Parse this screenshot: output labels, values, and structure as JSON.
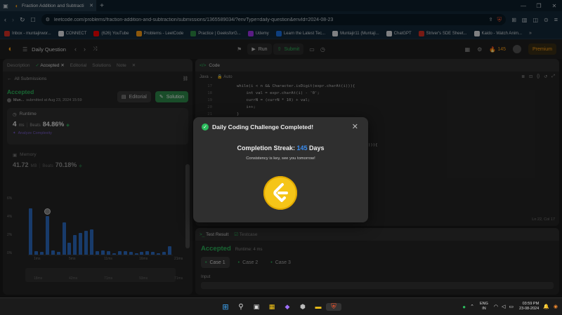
{
  "browser": {
    "tab_title": "Fraction Addition and Subtracti",
    "url": "leetcode.com/problems/fraction-addition-and-subtraction/submissions/1365589034/?envType=daily-question&envId=2024-08-23"
  },
  "bookmarks": [
    {
      "label": "Inbox - muntajirwor...",
      "color": "#d93025"
    },
    {
      "label": "CONNECT",
      "color": "#e8eaed"
    },
    {
      "label": "(626) YouTube",
      "color": "#ff0000"
    },
    {
      "label": "Problems - LeetCode",
      "color": "#ffa116"
    },
    {
      "label": "Practice | GeeksforG...",
      "color": "#2f8d46"
    },
    {
      "label": "Udemy",
      "color": "#a435f0"
    },
    {
      "label": "Learn the Latest Tec...",
      "color": "#1a73e8"
    },
    {
      "label": "Muntajir11 (Muntaji...",
      "color": "#e8eaed"
    },
    {
      "label": "ChatGPT",
      "color": "#e8eaed"
    },
    {
      "label": "Striver's SDE Sheet...",
      "color": "#d93025"
    },
    {
      "label": "Kaido - Watch Anim...",
      "color": "#e8eaed"
    }
  ],
  "lc": {
    "daily": "Daily Question",
    "run": "Run",
    "submit": "Submit",
    "streak": "145",
    "premium": "Premium"
  },
  "left": {
    "tabs": [
      "Description",
      "Accepted",
      "Editorial",
      "Solutions",
      "Note"
    ],
    "all_submissions": "All Submissions",
    "status": "Accepted",
    "user": "Mun...",
    "submitted": "submitted at Aug 23, 2024 15:59",
    "editorial_btn": "Editorial",
    "solution_btn": "Solution",
    "runtime_label": "Runtime",
    "runtime_val": "4",
    "runtime_unit": "ms",
    "beats_label": "Beats",
    "beats_val": "84.86%",
    "analyze": "Analyze Complexity",
    "memory_label": "Memory",
    "memory_val": "41.72",
    "memory_unit": "MB",
    "memory_beats_label": "Beats",
    "memory_beats": "70.18%",
    "y_ticks": [
      "6%",
      "4%",
      "2%",
      "0%"
    ],
    "x_ticks": [
      "1ms",
      "5ms",
      "11ms",
      "16ms",
      "21ms"
    ],
    "x_ticks2": [
      "18ms",
      "42ms",
      "71ms",
      "93ms",
      "71ms"
    ]
  },
  "chart_data": {
    "type": "bar",
    "title": "",
    "values": [
      5.5,
      0.4,
      0.3,
      4.6,
      0.5,
      0.3,
      3.8,
      1.4,
      2.3,
      2.6,
      2.8,
      3.0,
      0.4,
      0.5,
      0.4,
      0.2,
      0.4,
      0.4,
      0.3,
      0.2,
      0.3,
      0.4,
      0.3,
      0.2,
      0.3,
      1.0
    ],
    "highlight_index": 3,
    "ylim": [
      0,
      7
    ]
  },
  "code": {
    "header": "Code",
    "lang": "Java",
    "auto": "Auto",
    "lines": [
      {
        "n": "17",
        "t": "        while(i < n && Character.isDigit(expr.charAt(i))){"
      },
      {
        "n": "18",
        "t": "            int val = expr.charAt(i) - '0';"
      },
      {
        "n": "19",
        "t": "            currN = (currN * 10) + val;"
      },
      {
        "n": "20",
        "t": "            i++;"
      },
      {
        "n": "21",
        "t": "        }"
      }
    ],
    "frag": "))){",
    "position": "Ln 22, Col 17"
  },
  "bottom": {
    "test_result": "Test Result",
    "testcase": "Testcase",
    "accepted": "Accepted",
    "runtime": "Runtime: 4 ms",
    "cases": [
      "Case 1",
      "Case 2",
      "Case 3"
    ],
    "input_label": "Input"
  },
  "modal": {
    "title": "Daily Coding Challenge Completed!",
    "streak_label": "Completion Streak:",
    "streak_num": "145",
    "streak_unit": "Days",
    "message": "Consistency is key, see you tomorrow!"
  },
  "taskbar": {
    "lang1": "ENG",
    "lang2": "IN",
    "time": "03:59 PM",
    "date": "23-08-2024"
  }
}
